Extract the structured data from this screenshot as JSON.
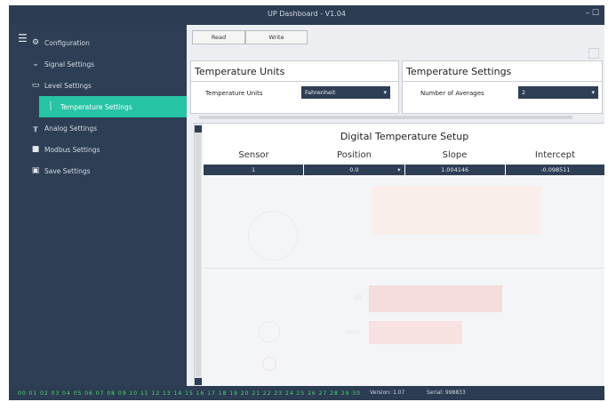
{
  "window": {
    "title": "UP Dashboard - V1.04",
    "controls": "– ☐"
  },
  "sidebar": {
    "items": [
      {
        "label": "Configuration",
        "icon": "gear-icon",
        "glyph": "⚙"
      },
      {
        "label": "Signal Settings",
        "icon": "chevron-down-icon",
        "glyph": "⌄"
      },
      {
        "label": "Level Settings",
        "icon": "bars-icon",
        "glyph": "▭"
      },
      {
        "label": "Temperature Settings",
        "icon": "thermometer-icon",
        "glyph": "│",
        "active": true
      },
      {
        "label": "Analog Settings",
        "icon": "stand-icon",
        "glyph": "╥"
      },
      {
        "label": "Modbus Settings",
        "icon": "device-icon",
        "glyph": "■"
      },
      {
        "label": "Save Settings",
        "icon": "save-icon",
        "glyph": "▣"
      }
    ]
  },
  "toolbar": {
    "read_label": "Read",
    "write_label": "Write"
  },
  "units_panel": {
    "title": "Temperature Units",
    "field_label": "Temperature Units",
    "value": "Fahrenheit"
  },
  "settings_panel": {
    "title": "Temperature Settings",
    "field_label": "Number of Averages",
    "value": "2"
  },
  "digital_setup": {
    "title": "Digital Temperature Setup",
    "columns": [
      "Sensor",
      "Position",
      "Slope",
      "Intercept"
    ],
    "rows": [
      {
        "sensor": "1",
        "position": "0.0",
        "slope": "1.004146",
        "intercept": "-0.098511"
      }
    ]
  },
  "statusbar": {
    "leds": "00 01 02 03 04 05 06 07 08 09 10 11 12 13 14 15 16 17 18 19 20 21 22 23 24 25 26 27 28 29 30",
    "version_label": "Version: 1.07",
    "serial_label": "Serial: 998833"
  },
  "colors": {
    "sidebar": "#2e3e54",
    "accent": "#27c3a5",
    "led": "#4dd86a"
  }
}
